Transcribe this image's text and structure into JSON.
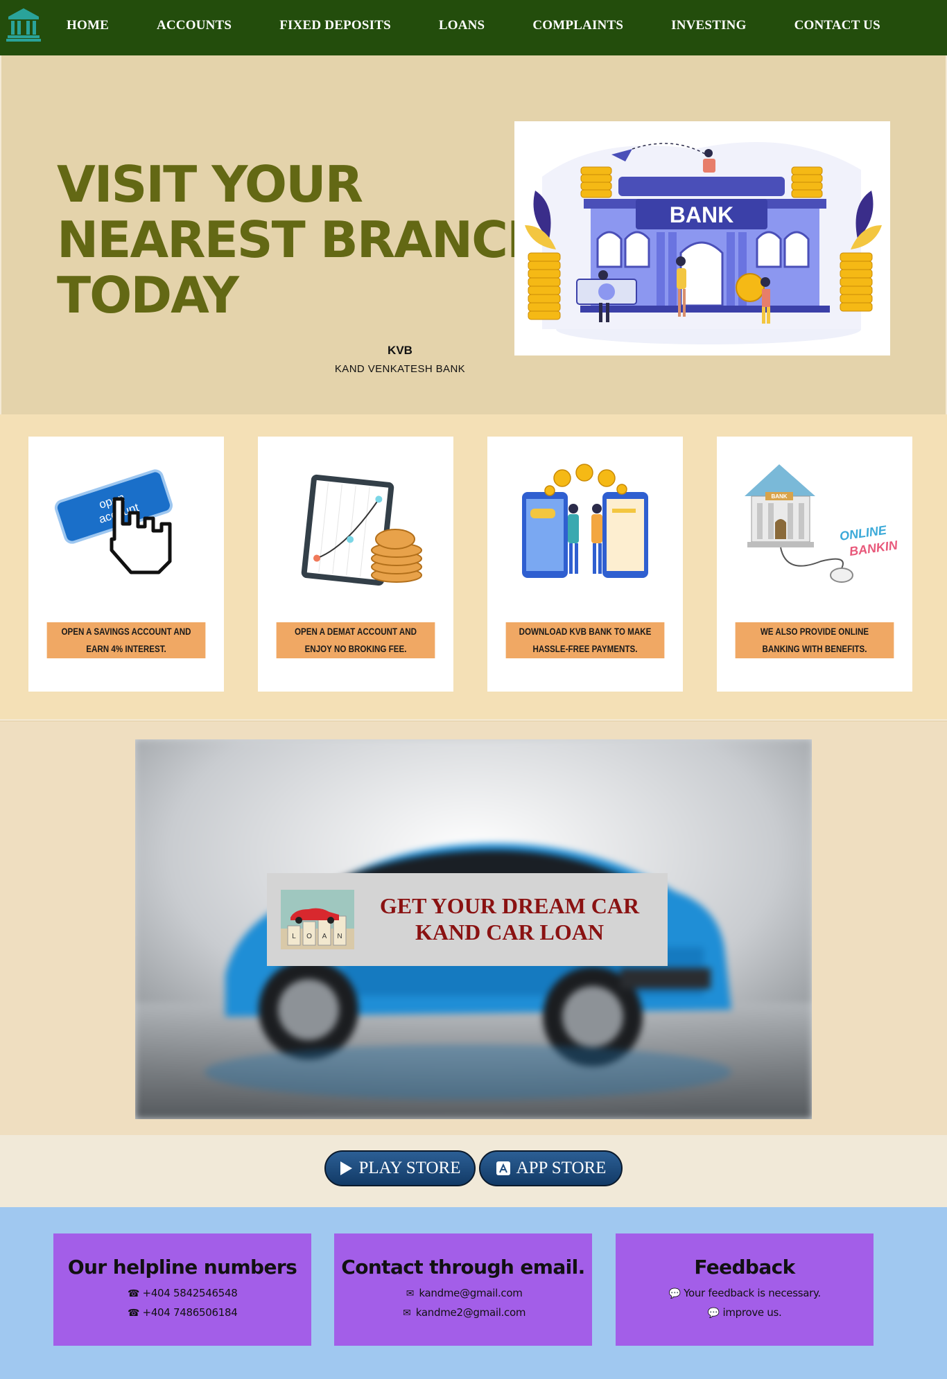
{
  "nav": {
    "items": [
      "HOME",
      "ACCOUNTS",
      "FIXED DEPOSITS",
      "LOANS",
      "COMPLAINTS",
      "INVESTING",
      "CONTACT US"
    ],
    "logo_icon": "bank-building-icon",
    "bg_color": "#234d0c"
  },
  "hero": {
    "title_lines": [
      "VISIT YOUR",
      "NEAREST BRANCH",
      "TODAY"
    ],
    "brand_name": "KVB",
    "brand_full": "KAND VENKATESH BANK",
    "image_sign": "BANK",
    "title_color": "#636814"
  },
  "cards": [
    {
      "label": "OPEN A SAVINGS ACCOUNT AND EARN 4% INTEREST.",
      "icon": "open-account-cursor-icon",
      "art_text": [
        "open",
        "account"
      ]
    },
    {
      "label": "OPEN A DEMAT ACCOUNT AND ENJOY NO BROKING FEE.",
      "icon": "stock-chart-coins-icon"
    },
    {
      "label": "DOWNLOAD KVB BANK TO MAKE HASSLE-FREE PAYMENTS.",
      "icon": "mobile-payment-icon"
    },
    {
      "label": "WE ALSO PROVIDE ONLINE BANKING WITH BENEFITS.",
      "icon": "online-banking-icon",
      "art_text": [
        "BANK",
        "ONLINE",
        "BANKIN"
      ]
    }
  ],
  "car_loan": {
    "lines": [
      "GET YOUR DREAM CAR",
      "KAND CAR LOAN"
    ],
    "thumb_letters": [
      "L",
      "O",
      "A",
      "N"
    ],
    "text_color": "#8a1212"
  },
  "store": {
    "play_label": "PLAY STORE",
    "app_label": "APP STORE"
  },
  "footer": {
    "boxes": [
      {
        "title": "Our helpline numbers",
        "lines": [
          "+404 5842546548",
          "+404 7486506184"
        ],
        "icons": [
          "phone-icon",
          "phone-icon"
        ]
      },
      {
        "title": "Contact through email.",
        "lines": [
          "kandme@gmail.com",
          "kandme2@gmail.com"
        ],
        "icons": [
          "envelope-icon",
          "envelope-icon"
        ]
      },
      {
        "title": "Feedback",
        "lines": [
          "Your feedback is necessary.",
          "improve us."
        ],
        "icons": [
          "comments-icon",
          "comments-icon"
        ]
      }
    ],
    "box_color": "#a35ee8",
    "bg_color": "#a0c8f0"
  }
}
